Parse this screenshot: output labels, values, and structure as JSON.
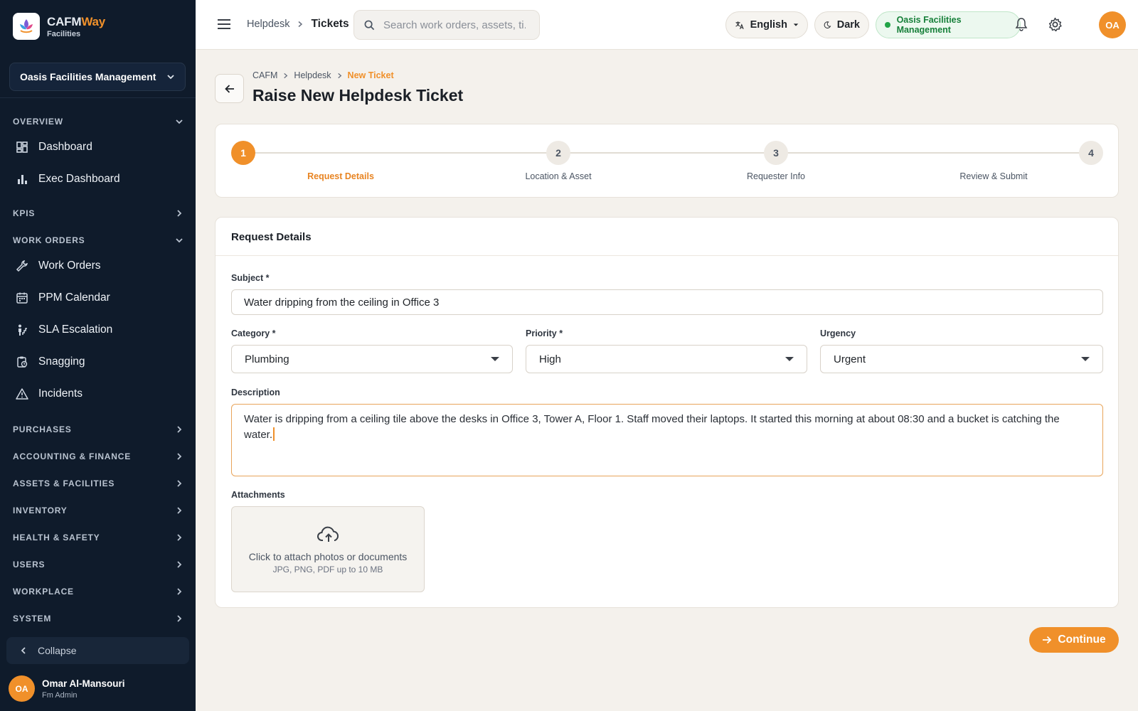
{
  "sidebar": {
    "brand_name_main": "CAFM",
    "brand_name_accent": "Way",
    "brand_sub": "Facilities",
    "org": "Oasis Facilities Management",
    "sections": {
      "overview": "OVERVIEW",
      "kpis": "KPIS",
      "work_orders": "WORK ORDERS",
      "purchases": "PURCHASES",
      "accounting": "ACCOUNTING & FINANCE",
      "assets": "ASSETS & FACILITIES",
      "inventory": "INVENTORY",
      "health": "HEALTH & SAFETY",
      "users": "USERS",
      "workplace": "WORKPLACE",
      "system": "SYSTEM"
    },
    "items": {
      "dashboard": "Dashboard",
      "exec_dashboard": "Exec Dashboard",
      "work_orders": "Work Orders",
      "ppm_calendar": "PPM Calendar",
      "sla_escalation": "SLA Escalation",
      "snagging": "Snagging",
      "incidents": "Incidents"
    },
    "collapse": "Collapse",
    "user": {
      "initials": "OA",
      "name": "Omar Al-Mansouri",
      "role": "Fm Admin"
    }
  },
  "topbar": {
    "breadcrumb_parent": "Helpdesk",
    "breadcrumb_current": "Tickets",
    "search_placeholder": "Search work orders, assets, ti...",
    "language": "English",
    "theme": "Dark",
    "org_badge": "Oasis Facilities Management",
    "avatar_initials": "OA"
  },
  "header": {
    "crumbs": [
      "CAFM",
      "Helpdesk",
      "New Ticket"
    ],
    "title": "Raise New Helpdesk Ticket"
  },
  "stepper": {
    "current": 1,
    "steps": [
      {
        "num": "1",
        "label": "Request Details"
      },
      {
        "num": "2",
        "label": "Location & Asset"
      },
      {
        "num": "3",
        "label": "Requester Info"
      },
      {
        "num": "4",
        "label": "Review & Submit"
      }
    ]
  },
  "form": {
    "section_title": "Request Details",
    "subject_label": "Subject *",
    "subject_value": "Water dripping from the ceiling in Office 3",
    "category_label": "Category *",
    "category_value": "Plumbing",
    "priority_label": "Priority *",
    "priority_value": "High",
    "urgency_label": "Urgency",
    "urgency_value": "Urgent",
    "description_label": "Description",
    "description_value": "Water is dripping from a ceiling tile above the desks in Office 3, Tower A, Floor 1. Staff moved their laptops. It started this morning at about 08:30 and a bucket is catching the water.",
    "attachments_label": "Attachments",
    "attach_main": "Click to attach photos or documents",
    "attach_sub": "JPG, PNG, PDF up to 10 MB"
  },
  "actions": {
    "continue": "Continue"
  },
  "colors": {
    "accent": "#f0902a",
    "sidebar_bg": "#0f1b2b",
    "success": "#22a447"
  }
}
